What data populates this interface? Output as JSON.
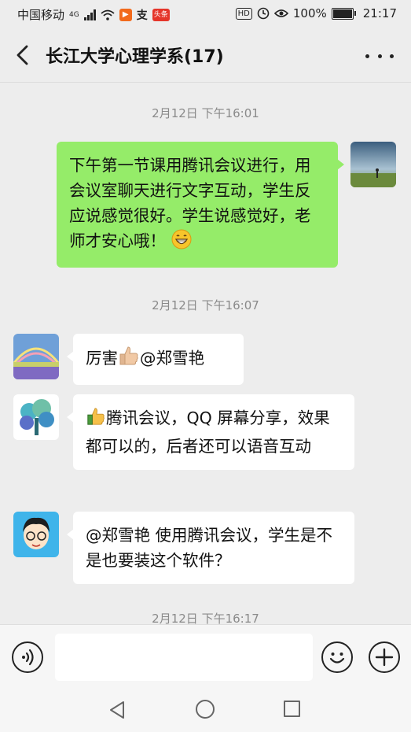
{
  "status_bar": {
    "carrier": "中国移动",
    "network": "4G",
    "badge_hd": "HD",
    "battery": "100%",
    "time": "21:17",
    "app_badge_1": "支",
    "app_badge_2": "头条"
  },
  "header": {
    "title": "长江大学心理学系(17)"
  },
  "messages": [
    {
      "type": "timestamp",
      "text": "2月12日 下午16:01"
    },
    {
      "type": "message",
      "side": "right",
      "text": "下午第一节课用腾讯会议进行，用会议室聊天进行文字互动，学生反应说感觉很好。学生说感觉好，老师才安心哦！",
      "emoji": "grinning-face"
    },
    {
      "type": "timestamp",
      "text": "2月12日 下午16:07"
    },
    {
      "type": "message",
      "side": "left",
      "text_before": "厉害",
      "emoji": "thumbs-up",
      "text_after": "@郑雪艳"
    },
    {
      "type": "message",
      "side": "left",
      "emoji": "thumbs-up",
      "text": "腾讯会议，QQ 屏幕分享，效果都可以的，后者还可以语音互动"
    },
    {
      "type": "message",
      "side": "left",
      "text": "@郑雪艳  使用腾讯会议，学生是不是也要装这个软件？"
    },
    {
      "type": "timestamp",
      "text": "2月12日 下午16:17"
    }
  ],
  "colors": {
    "background": "#ededed",
    "bubble_self": "#95ec69",
    "bubble_other": "#ffffff",
    "timestamp": "#8a8a8a"
  }
}
